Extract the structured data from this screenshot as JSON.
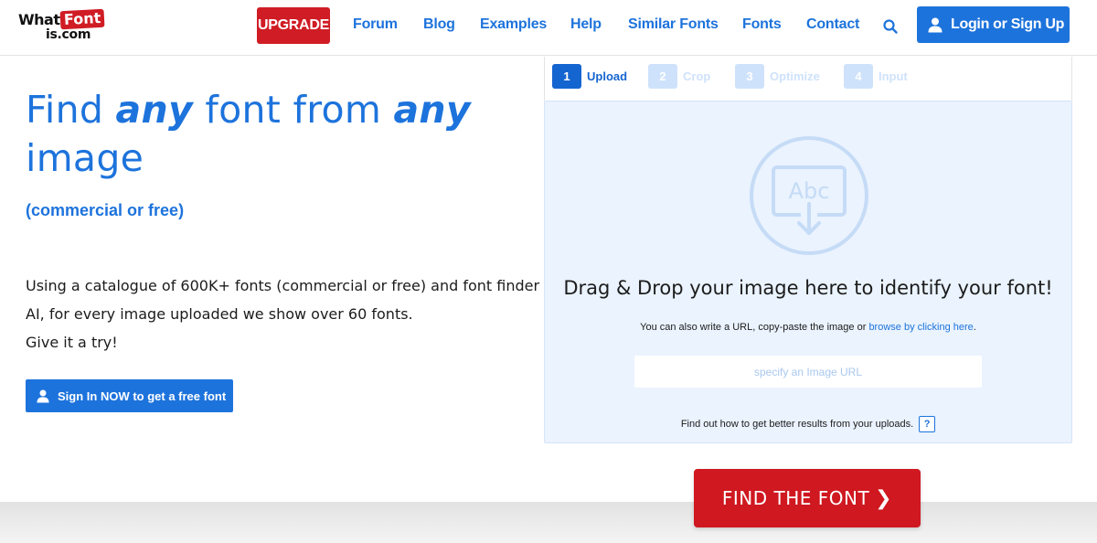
{
  "header": {
    "logo": {
      "line1_what": "What",
      "line1_font": "Font",
      "line2": "is.com"
    },
    "upgrade_label": "UPGRADE",
    "nav": [
      {
        "label": "Forum"
      },
      {
        "label": "Blog"
      },
      {
        "label": "Examples"
      },
      {
        "label": "Help"
      },
      {
        "label": "Similar Fonts"
      },
      {
        "label": "Fonts"
      },
      {
        "label": "Contact"
      }
    ],
    "search_icon": "search-icon",
    "login_label": "Login or Sign Up"
  },
  "hero": {
    "title_part1": "Find ",
    "title_em1": "any",
    "title_part2": " font from ",
    "title_em2": "any",
    "title_part3": " image",
    "subtitle": "(commercial or free)",
    "desc_line1": "Using a catalogue of 600K+ fonts (commercial or free) and font finder",
    "desc_line2": "AI, for every image uploaded we show over 60 fonts.",
    "desc_line3": "Give it a try!",
    "signin_label": "Sign In NOW to get a free font"
  },
  "steps": [
    {
      "num": "1",
      "label": "Upload",
      "state": "active"
    },
    {
      "num": "2",
      "label": "Crop",
      "state": "inactive"
    },
    {
      "num": "3",
      "label": "Optimize",
      "state": "inactive"
    },
    {
      "num": "4",
      "label": "Input",
      "state": "inactive"
    }
  ],
  "dropzone": {
    "graphic_text": "Abc",
    "title": "Drag & Drop your image here to identify your font!",
    "note_prefix": "You can also write a URL, copy-paste the image or ",
    "note_link": "browse by clicking here",
    "note_suffix": ".",
    "url_placeholder": "specify an Image URL",
    "tips_text": "Find out how to get better results from your uploads.",
    "help_label": "?"
  },
  "find_button": {
    "label": "FIND THE FONT",
    "chevron": "❯"
  },
  "colors": {
    "brand_blue": "#1d73dc",
    "brand_red": "#d01c24",
    "drop_bg": "#eaf3fe"
  }
}
